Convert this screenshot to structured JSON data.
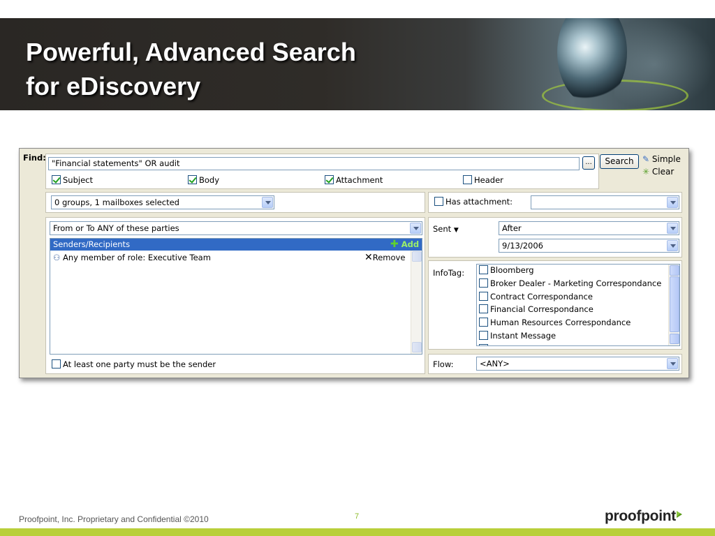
{
  "slide": {
    "title_line1": "Powerful, Advanced Search",
    "title_line2": "for eDiscovery",
    "footer": "Proofpoint, Inc. Proprietary and Confidential ©2010",
    "page_number": "7",
    "logo_text": "proofpoint"
  },
  "find": {
    "label": "Find:",
    "query": "\"Financial statements\" OR audit",
    "browse_label": "...",
    "search_label": "Search",
    "simple_label": "Simple",
    "clear_label": "Clear",
    "scopes": [
      {
        "label": "Subject",
        "checked": true
      },
      {
        "label": "Body",
        "checked": true
      },
      {
        "label": "Attachment",
        "checked": true
      },
      {
        "label": "Header",
        "checked": false
      }
    ]
  },
  "mailbox_select": {
    "value": "0 groups, 1 mailboxes selected"
  },
  "parties": {
    "mode": "From or To ANY of these parties",
    "list_header": "Senders/Recipients",
    "add_label": "Add",
    "items": [
      {
        "label": "Any member of role: Executive Team",
        "remove_label": "Remove"
      }
    ],
    "sender_checkbox": "At least one party must be the sender"
  },
  "attachment": {
    "label": "Has attachment:",
    "value": ""
  },
  "sent": {
    "label": "Sent",
    "operator": "After",
    "date": "9/13/2006"
  },
  "infotag": {
    "label": "InfoTag:",
    "items": [
      "Bloomberg",
      "Broker Dealer - Marketing Correspondance",
      "Contract Correspondance",
      "Financial Correspondance",
      "Human Resources Correspondance",
      "Instant Message"
    ]
  },
  "flow": {
    "label": "Flow:",
    "value": "<ANY>"
  },
  "colors": {
    "accent_green": "#b9cf3a",
    "selection_blue": "#316ac5"
  }
}
